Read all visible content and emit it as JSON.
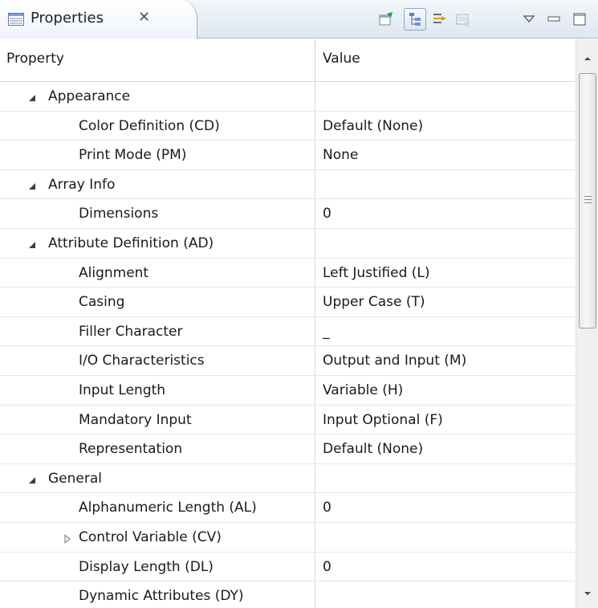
{
  "view": {
    "tab_title": "Properties",
    "tab_close_glyph": "✕",
    "tab_icon": "properties-table-icon",
    "toolbar": [
      {
        "name": "pin-to-selection-icon",
        "pressed": false
      },
      {
        "name": "show-categories-icon",
        "pressed": true
      },
      {
        "name": "show-advanced-icon",
        "pressed": false
      },
      {
        "name": "restore-defaults-icon",
        "pressed": false
      },
      {
        "name": "view-menu-icon",
        "pressed": false
      },
      {
        "name": "minimize-icon",
        "pressed": false
      },
      {
        "name": "maximize-icon",
        "pressed": false
      }
    ]
  },
  "table": {
    "columns": {
      "property": "Property",
      "value": "Value"
    },
    "rows": [
      {
        "label": "Appearance",
        "value": "",
        "level": 0,
        "twisty": "expanded"
      },
      {
        "label": "Color Definition (CD)",
        "value": "Default (None)",
        "level": 1,
        "twisty": "none"
      },
      {
        "label": "Print Mode (PM)",
        "value": "None",
        "level": 1,
        "twisty": "none"
      },
      {
        "label": "Array Info",
        "value": "",
        "level": 0,
        "twisty": "expanded"
      },
      {
        "label": "Dimensions",
        "value": "0",
        "level": 1,
        "twisty": "none"
      },
      {
        "label": "Attribute Definition (AD)",
        "value": "",
        "level": 0,
        "twisty": "expanded"
      },
      {
        "label": "Alignment",
        "value": "Left Justified (L)",
        "level": 1,
        "twisty": "none"
      },
      {
        "label": "Casing",
        "value": "Upper Case (T)",
        "level": 1,
        "twisty": "none"
      },
      {
        "label": "Filler Character",
        "value": "_",
        "level": 1,
        "twisty": "none"
      },
      {
        "label": "I/O Characteristics",
        "value": "Output and Input (M)",
        "level": 1,
        "twisty": "none"
      },
      {
        "label": "Input Length",
        "value": "Variable (H)",
        "level": 1,
        "twisty": "none"
      },
      {
        "label": "Mandatory Input",
        "value": "Input Optional (F)",
        "level": 1,
        "twisty": "none"
      },
      {
        "label": "Representation",
        "value": "Default (None)",
        "level": 1,
        "twisty": "none"
      },
      {
        "label": "General",
        "value": "",
        "level": 0,
        "twisty": "expanded"
      },
      {
        "label": "Alphanumeric Length (AL)",
        "value": "0",
        "level": 1,
        "twisty": "none"
      },
      {
        "label": "Control Variable (CV)",
        "value": "",
        "level": 1,
        "twisty": "collapsed"
      },
      {
        "label": "Display Length (DL)",
        "value": "0",
        "level": 1,
        "twisty": "none"
      },
      {
        "label": "Dynamic Attributes (DY)",
        "value": "",
        "level": 1,
        "twisty": "none"
      }
    ]
  },
  "scrollbar": {
    "position": 0.0,
    "visible_fraction": 0.5
  },
  "colors": {
    "titlebar": "#dde6f2",
    "border": "#a9bbd3",
    "grid": "#e6e6e6",
    "twisty": "#3c3c3c"
  }
}
